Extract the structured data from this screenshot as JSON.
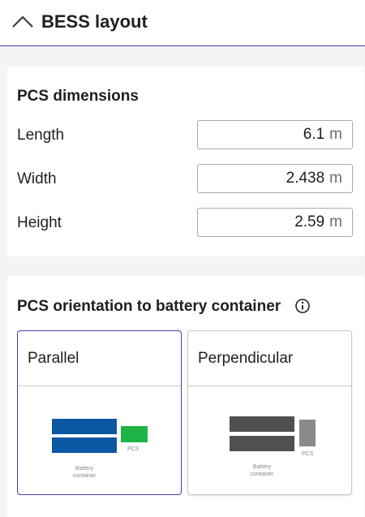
{
  "header": {
    "title": "BESS layout",
    "toggle_icon": "chevron-up-icon"
  },
  "pcs_dimensions": {
    "title": "PCS dimensions",
    "fields": [
      {
        "label": "Length",
        "value": "6.1",
        "unit": "m"
      },
      {
        "label": "Width",
        "value": "2.438",
        "unit": "m"
      },
      {
        "label": "Height",
        "value": "2.59",
        "unit": "m"
      }
    ]
  },
  "orientation": {
    "title": "PCS orientation to battery container",
    "info_icon": "info-icon",
    "selected": "Parallel",
    "options": [
      {
        "label": "Parallel",
        "battery_label_1": "Battery",
        "battery_label_2": "container",
        "pcs_label": "PCS",
        "battery_color": "#0b57a4",
        "pcs_color": "#1db445"
      },
      {
        "label": "Perpendicular",
        "battery_label_1": "Battery",
        "battery_label_2": "container",
        "pcs_label": "PCS",
        "battery_color": "#505050",
        "pcs_color": "#8a8a8a"
      }
    ]
  },
  "colors": {
    "accent": "#4b3fa6",
    "background": "#f4f4f4"
  }
}
